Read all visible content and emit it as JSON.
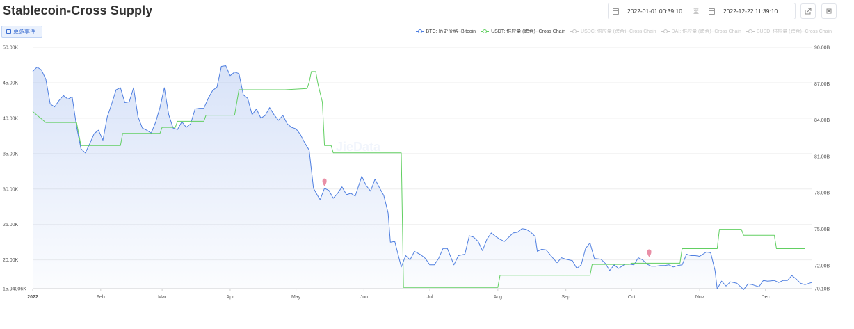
{
  "page": {
    "title": "Stablecoin-Cross Supply",
    "events_button": "更多事件",
    "watermark": "JieData"
  },
  "date_range": {
    "start": "2022-01-01 00:39:10",
    "separator": "至",
    "end": "2022-12-22 11:39:10"
  },
  "toolbar": {
    "export_icon": "export-icon",
    "fullscreen_icon": "fullscreen-icon"
  },
  "colors": {
    "btc": "#4f7fe0",
    "usdt": "#62cf62",
    "inactive": "#c6c6c6",
    "marker": "#e98fa6"
  },
  "chart_data": {
    "type": "line",
    "legend": [
      {
        "name": "BTC: 历史价格--Bitcoin",
        "active": true
      },
      {
        "name": "USDT: 供应量 (跨合)--Cross Chain",
        "active": true
      },
      {
        "name": "USDC: 供应量 (跨合)--Cross Chain",
        "active": false
      },
      {
        "name": "DAI: 供应量 (跨合)--Cross Chain",
        "active": false
      },
      {
        "name": "BUSD: 供应量 (跨合)--Cross Chain",
        "active": false
      }
    ],
    "legend_position": "top-right",
    "x_range": [
      "2022-01-01",
      "2022-12-22"
    ],
    "x_ticks": [
      {
        "label": "2022",
        "date": "2022-01-01",
        "bold": true
      },
      {
        "label": "Feb",
        "date": "2022-02-01"
      },
      {
        "label": "Mar",
        "date": "2022-03-01"
      },
      {
        "label": "Apr",
        "date": "2022-04-01"
      },
      {
        "label": "May",
        "date": "2022-05-01"
      },
      {
        "label": "Jun",
        "date": "2022-06-01"
      },
      {
        "label": "Jul",
        "date": "2022-07-01"
      },
      {
        "label": "Aug",
        "date": "2022-08-01"
      },
      {
        "label": "Sep",
        "date": "2022-09-01"
      },
      {
        "label": "Oct",
        "date": "2022-10-01"
      },
      {
        "label": "Nov",
        "date": "2022-11-01"
      },
      {
        "label": "Dec",
        "date": "2022-12-01"
      }
    ],
    "y_left": {
      "min": 15940.06,
      "max": 50000,
      "ticks": [
        {
          "label": "50.00K",
          "value": 50000
        },
        {
          "label": "45.00K",
          "value": 45000
        },
        {
          "label": "40.00K",
          "value": 40000
        },
        {
          "label": "35.00K",
          "value": 35000
        },
        {
          "label": "30.00K",
          "value": 30000
        },
        {
          "label": "25.00K",
          "value": 25000
        },
        {
          "label": "20.00K",
          "value": 20000
        },
        {
          "label": "15.94006K",
          "value": 15940.06
        }
      ]
    },
    "y_right": {
      "min": 70.1,
      "max": 90,
      "ticks": [
        {
          "label": "90.00B",
          "value": 90
        },
        {
          "label": "87.00B",
          "value": 87
        },
        {
          "label": "84.00B",
          "value": 84
        },
        {
          "label": "81.00B",
          "value": 81
        },
        {
          "label": "78.00B",
          "value": 78
        },
        {
          "label": "75.00B",
          "value": 75
        },
        {
          "label": "72.00B",
          "value": 72
        },
        {
          "label": "70.10B",
          "value": 70.1
        }
      ]
    },
    "grid": true,
    "series": [
      {
        "name": "BTC: 历史价格--Bitcoin",
        "axis": "left",
        "area": true,
        "points": [
          [
            "2022-01-01",
            46600
          ],
          [
            "2022-01-03",
            47200
          ],
          [
            "2022-01-05",
            46800
          ],
          [
            "2022-01-07",
            45500
          ],
          [
            "2022-01-09",
            42000
          ],
          [
            "2022-01-11",
            41600
          ],
          [
            "2022-01-13",
            42500
          ],
          [
            "2022-01-15",
            43200
          ],
          [
            "2022-01-17",
            42700
          ],
          [
            "2022-01-19",
            43000
          ],
          [
            "2022-01-21",
            38800
          ],
          [
            "2022-01-23",
            35700
          ],
          [
            "2022-01-25",
            35100
          ],
          [
            "2022-01-27",
            36400
          ],
          [
            "2022-01-29",
            37800
          ],
          [
            "2022-01-31",
            38300
          ],
          [
            "2022-02-02",
            36900
          ],
          [
            "2022-02-04",
            40200
          ],
          [
            "2022-02-06",
            42000
          ],
          [
            "2022-02-08",
            44000
          ],
          [
            "2022-02-10",
            44300
          ],
          [
            "2022-02-12",
            42200
          ],
          [
            "2022-02-14",
            42300
          ],
          [
            "2022-02-16",
            44300
          ],
          [
            "2022-02-18",
            40200
          ],
          [
            "2022-02-20",
            38600
          ],
          [
            "2022-02-22",
            38300
          ],
          [
            "2022-02-24",
            37900
          ],
          [
            "2022-02-26",
            39400
          ],
          [
            "2022-02-28",
            41500
          ],
          [
            "2022-03-02",
            44300
          ],
          [
            "2022-03-04",
            40500
          ],
          [
            "2022-03-06",
            38600
          ],
          [
            "2022-03-08",
            38400
          ],
          [
            "2022-03-10",
            39500
          ],
          [
            "2022-03-12",
            38700
          ],
          [
            "2022-03-14",
            39200
          ],
          [
            "2022-03-16",
            41300
          ],
          [
            "2022-03-18",
            41400
          ],
          [
            "2022-03-20",
            41400
          ],
          [
            "2022-03-22",
            42800
          ],
          [
            "2022-03-24",
            43900
          ],
          [
            "2022-03-26",
            44400
          ],
          [
            "2022-03-28",
            47300
          ],
          [
            "2022-03-30",
            47400
          ],
          [
            "2022-04-01",
            46000
          ],
          [
            "2022-04-03",
            46500
          ],
          [
            "2022-04-05",
            46300
          ],
          [
            "2022-04-07",
            43300
          ],
          [
            "2022-04-09",
            42800
          ],
          [
            "2022-04-11",
            40500
          ],
          [
            "2022-04-13",
            41300
          ],
          [
            "2022-04-15",
            40000
          ],
          [
            "2022-04-17",
            40400
          ],
          [
            "2022-04-19",
            41500
          ],
          [
            "2022-04-21",
            40500
          ],
          [
            "2022-04-23",
            39700
          ],
          [
            "2022-04-25",
            40400
          ],
          [
            "2022-04-27",
            39200
          ],
          [
            "2022-04-29",
            38700
          ],
          [
            "2022-05-01",
            38500
          ],
          [
            "2022-05-03",
            37700
          ],
          [
            "2022-05-05",
            36500
          ],
          [
            "2022-05-07",
            35500
          ],
          [
            "2022-05-09",
            30100
          ],
          [
            "2022-05-11",
            29000
          ],
          [
            "2022-05-12",
            28500
          ],
          [
            "2022-05-14",
            30100
          ],
          [
            "2022-05-16",
            29800
          ],
          [
            "2022-05-18",
            28700
          ],
          [
            "2022-05-20",
            29400
          ],
          [
            "2022-05-22",
            30300
          ],
          [
            "2022-05-24",
            29200
          ],
          [
            "2022-05-26",
            29400
          ],
          [
            "2022-05-28",
            29000
          ],
          [
            "2022-05-31",
            31800
          ],
          [
            "2022-06-02",
            30500
          ],
          [
            "2022-06-04",
            29700
          ],
          [
            "2022-06-06",
            31400
          ],
          [
            "2022-06-08",
            30200
          ],
          [
            "2022-06-10",
            29100
          ],
          [
            "2022-06-12",
            26600
          ],
          [
            "2022-06-13",
            22500
          ],
          [
            "2022-06-15",
            22600
          ],
          [
            "2022-06-18",
            19000
          ],
          [
            "2022-06-20",
            20600
          ],
          [
            "2022-06-22",
            20000
          ],
          [
            "2022-06-24",
            21200
          ],
          [
            "2022-06-27",
            20700
          ],
          [
            "2022-06-29",
            20200
          ],
          [
            "2022-07-01",
            19300
          ],
          [
            "2022-07-03",
            19300
          ],
          [
            "2022-07-05",
            20200
          ],
          [
            "2022-07-07",
            21600
          ],
          [
            "2022-07-09",
            21600
          ],
          [
            "2022-07-12",
            19300
          ],
          [
            "2022-07-14",
            20600
          ],
          [
            "2022-07-17",
            20800
          ],
          [
            "2022-07-19",
            23400
          ],
          [
            "2022-07-21",
            23200
          ],
          [
            "2022-07-23",
            22600
          ],
          [
            "2022-07-25",
            21300
          ],
          [
            "2022-07-27",
            22900
          ],
          [
            "2022-07-29",
            23800
          ],
          [
            "2022-07-31",
            23300
          ],
          [
            "2022-08-02",
            22900
          ],
          [
            "2022-08-04",
            22600
          ],
          [
            "2022-08-06",
            23200
          ],
          [
            "2022-08-08",
            23800
          ],
          [
            "2022-08-10",
            23900
          ],
          [
            "2022-08-12",
            24400
          ],
          [
            "2022-08-14",
            24300
          ],
          [
            "2022-08-16",
            23900
          ],
          [
            "2022-08-18",
            23300
          ],
          [
            "2022-08-19",
            21200
          ],
          [
            "2022-08-21",
            21500
          ],
          [
            "2022-08-23",
            21400
          ],
          [
            "2022-08-26",
            20300
          ],
          [
            "2022-08-28",
            19600
          ],
          [
            "2022-08-30",
            20300
          ],
          [
            "2022-09-01",
            20100
          ],
          [
            "2022-09-04",
            19900
          ],
          [
            "2022-09-06",
            18800
          ],
          [
            "2022-09-08",
            19300
          ],
          [
            "2022-09-10",
            21600
          ],
          [
            "2022-09-12",
            22400
          ],
          [
            "2022-09-14",
            20200
          ],
          [
            "2022-09-17",
            20100
          ],
          [
            "2022-09-19",
            19500
          ],
          [
            "2022-09-21",
            18500
          ],
          [
            "2022-09-23",
            19300
          ],
          [
            "2022-09-25",
            18800
          ],
          [
            "2022-09-28",
            19400
          ],
          [
            "2022-09-30",
            19400
          ],
          [
            "2022-10-02",
            19300
          ],
          [
            "2022-10-04",
            20300
          ],
          [
            "2022-10-06",
            20000
          ],
          [
            "2022-10-08",
            19400
          ],
          [
            "2022-10-10",
            19100
          ],
          [
            "2022-10-12",
            19100
          ],
          [
            "2022-10-14",
            19200
          ],
          [
            "2022-10-16",
            19200
          ],
          [
            "2022-10-18",
            19300
          ],
          [
            "2022-10-20",
            19000
          ],
          [
            "2022-10-22",
            19200
          ],
          [
            "2022-10-24",
            19300
          ],
          [
            "2022-10-26",
            20800
          ],
          [
            "2022-10-28",
            20600
          ],
          [
            "2022-10-30",
            20600
          ],
          [
            "2022-11-01",
            20500
          ],
          [
            "2022-11-04",
            21100
          ],
          [
            "2022-11-06",
            21000
          ],
          [
            "2022-11-08",
            18500
          ],
          [
            "2022-11-09",
            15900
          ],
          [
            "2022-11-11",
            17000
          ],
          [
            "2022-11-13",
            16300
          ],
          [
            "2022-11-15",
            16900
          ],
          [
            "2022-11-18",
            16700
          ],
          [
            "2022-11-21",
            15800
          ],
          [
            "2022-11-23",
            16600
          ],
          [
            "2022-11-25",
            16500
          ],
          [
            "2022-11-28",
            16200
          ],
          [
            "2022-11-30",
            17100
          ],
          [
            "2022-12-02",
            17000
          ],
          [
            "2022-12-05",
            17100
          ],
          [
            "2022-12-07",
            16800
          ],
          [
            "2022-12-09",
            17100
          ],
          [
            "2022-12-11",
            17100
          ],
          [
            "2022-12-13",
            17800
          ],
          [
            "2022-12-15",
            17300
          ],
          [
            "2022-12-17",
            16700
          ],
          [
            "2022-12-19",
            16500
          ],
          [
            "2022-12-22",
            16800
          ]
        ]
      },
      {
        "name": "USDT: 供应量 (跨合)--Cross Chain",
        "axis": "right",
        "step": true,
        "points": [
          [
            "2022-01-01",
            84.7
          ],
          [
            "2022-01-07",
            83.8
          ],
          [
            "2022-01-21",
            83.8
          ],
          [
            "2022-01-23",
            81.9
          ],
          [
            "2022-02-10",
            81.9
          ],
          [
            "2022-02-11",
            82.9
          ],
          [
            "2022-02-28",
            82.9
          ],
          [
            "2022-03-01",
            83.4
          ],
          [
            "2022-03-07",
            83.4
          ],
          [
            "2022-03-08",
            83.9
          ],
          [
            "2022-03-20",
            83.9
          ],
          [
            "2022-03-21",
            84.4
          ],
          [
            "2022-04-03",
            84.4
          ],
          [
            "2022-04-05",
            86.5
          ],
          [
            "2022-04-26",
            86.5
          ],
          [
            "2022-05-06",
            86.6
          ],
          [
            "2022-05-07",
            87.1
          ],
          [
            "2022-05-08",
            88.0
          ],
          [
            "2022-05-10",
            88.0
          ],
          [
            "2022-05-11",
            87.0
          ],
          [
            "2022-05-13",
            85.5
          ],
          [
            "2022-05-14",
            81.9
          ],
          [
            "2022-05-17",
            81.9
          ],
          [
            "2022-05-18",
            81.3
          ],
          [
            "2022-06-18",
            81.3
          ],
          [
            "2022-06-19",
            70.2
          ],
          [
            "2022-08-01",
            70.2
          ],
          [
            "2022-08-02",
            71.2
          ],
          [
            "2022-09-12",
            71.2
          ],
          [
            "2022-09-13",
            72.1
          ],
          [
            "2022-09-30",
            72.1
          ],
          [
            "2022-10-01",
            72.2
          ],
          [
            "2022-10-23",
            72.2
          ],
          [
            "2022-10-24",
            73.4
          ],
          [
            "2022-11-09",
            73.4
          ],
          [
            "2022-11-10",
            75.0
          ],
          [
            "2022-11-20",
            75.0
          ],
          [
            "2022-11-21",
            74.5
          ],
          [
            "2022-12-05",
            74.5
          ],
          [
            "2022-12-06",
            73.4
          ],
          [
            "2022-12-19",
            73.4
          ]
        ]
      }
    ],
    "markers": [
      {
        "date": "2022-05-14",
        "value": 30900,
        "axis": "left"
      },
      {
        "date": "2022-10-09",
        "value": 20900,
        "axis": "left"
      }
    ]
  }
}
